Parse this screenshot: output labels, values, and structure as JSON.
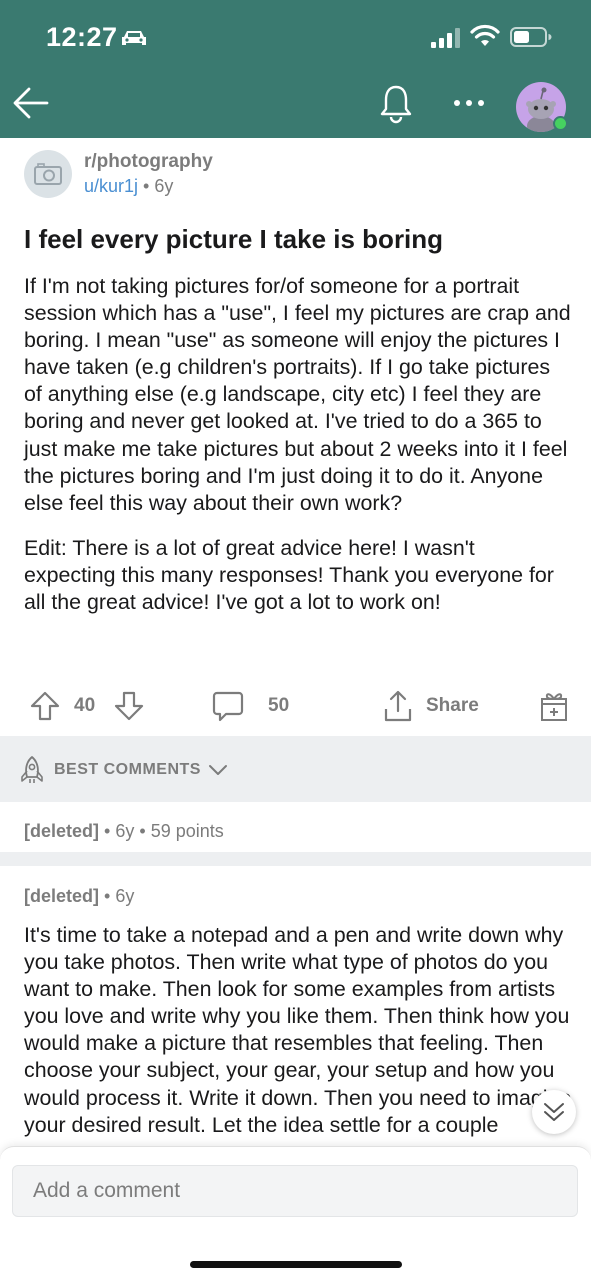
{
  "status": {
    "time": "12:27"
  },
  "post": {
    "subreddit": "r/photography",
    "author": "u/kur1j",
    "age": "6y",
    "title": "I feel every picture I take is boring",
    "body_paragraphs": [
      "If I'm not taking pictures for/of someone for a portrait session which has a \"use\", I feel my pictures are crap and boring. I mean \"use\" as someone will enjoy the pictures I have taken (e.g children's portraits). If I go take pictures of anything   else (e.g landscape, city etc) I feel they are boring and never get looked at. I've tried to do a 365 to just make me take pictures but about 2 weeks into it I feel the pictures boring and I'm just doing it to do it. Anyone else feel this way about their own work?",
      "Edit: There is a lot of great advice here! I wasn't expecting this many responses! Thank you everyone for all the great advice! I've got a lot to work on!"
    ],
    "score": "40",
    "comment_count": "50",
    "share_label": "Share"
  },
  "sort": {
    "label": "BEST COMMENTS"
  },
  "comments": [
    {
      "author": "[deleted]",
      "age": "6y",
      "points": "59 points"
    },
    {
      "author": "[deleted]",
      "age": "6y",
      "body": "It's time to take a notepad and a pen and write down why you take photos. Then write what type of photos do you want to make. Then look for some examples from artists you love and write why you like them. Then think how you would make a picture that resembles that feeling. Then choose your subject, your gear, your setup and how you would process it. Write it down. Then you need to imagine your desired result. Let the idea settle for a couple"
    }
  ],
  "composer": {
    "placeholder": "Add a comment"
  },
  "colors": {
    "header": "#3a7a70",
    "link": "#4a8fd2",
    "muted": "#7c7c7c",
    "avatar": "#c6a3e8",
    "online": "#46d160"
  },
  "icons": [
    "car-icon",
    "signal-icon",
    "wifi-icon",
    "battery-icon",
    "back-arrow-icon",
    "bell-icon",
    "more-icon",
    "camera-icon",
    "upvote-icon",
    "downvote-icon",
    "comment-icon",
    "share-icon",
    "award-icon",
    "rocket-icon",
    "chevron-down-icon",
    "double-chevron-down-icon"
  ]
}
